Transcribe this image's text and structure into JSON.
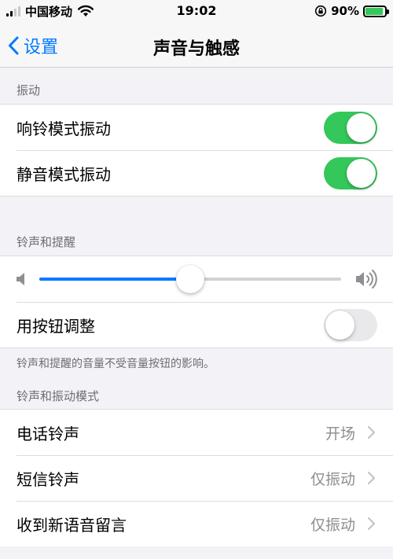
{
  "status_bar": {
    "carrier": "中国移动",
    "time": "19:02",
    "battery_percent": "90%",
    "battery_level": 0.9,
    "icons": [
      "signal-icon",
      "wifi-icon",
      "rotation-lock-icon",
      "battery-charging-icon"
    ]
  },
  "nav": {
    "back_label": "设置",
    "title": "声音与触感"
  },
  "vibration": {
    "header": "振动",
    "items": [
      {
        "label": "响铃模式振动",
        "on": true
      },
      {
        "label": "静音模式振动",
        "on": true
      }
    ]
  },
  "ringer": {
    "header": "铃声和提醒",
    "volume": 0.5,
    "change_with_buttons": {
      "label": "用按钮调整",
      "on": false
    },
    "footer": "铃声和提醒的音量不受音量按钮的影响。"
  },
  "patterns": {
    "header": "铃声和振动模式",
    "items": [
      {
        "label": "电话铃声",
        "value": "开场"
      },
      {
        "label": "短信铃声",
        "value": "仅振动"
      },
      {
        "label": "收到新语音留言",
        "value": "仅振动"
      }
    ]
  },
  "colors": {
    "accent": "#007aff",
    "toggle_on": "#34c759",
    "secondary_text": "#8e8e93",
    "background": "#f2f2f7"
  }
}
